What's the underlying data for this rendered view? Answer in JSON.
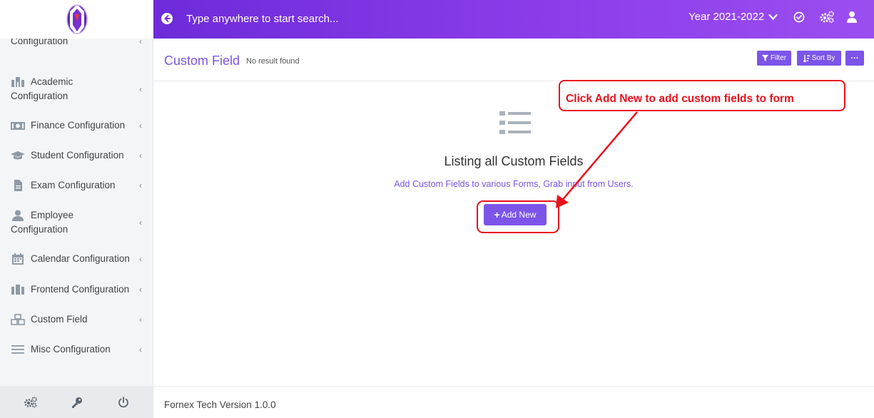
{
  "sidebar": {
    "items": [
      {
        "icon": "reception-icon",
        "line1": "",
        "line2": "Configuration"
      },
      {
        "icon": "academic-icon",
        "line1": "Academic",
        "line2": "Configuration"
      },
      {
        "icon": "finance-icon",
        "label": "Finance Configuration"
      },
      {
        "icon": "graduation-cap-icon",
        "label": "Student Configuration"
      },
      {
        "icon": "file-icon",
        "label": "Exam Configuration"
      },
      {
        "icon": "employee-icon",
        "line1": "Employee",
        "line2": "Configuration"
      },
      {
        "icon": "calendar-icon",
        "label": "Calendar Configuration"
      },
      {
        "icon": "frontend-icon",
        "label": "Frontend Configuration"
      },
      {
        "icon": "cubes-icon",
        "label": "Custom Field"
      },
      {
        "icon": "bars-icon",
        "label": "Misc Configuration"
      }
    ],
    "chevron": "‹",
    "bottom_icons": [
      "cogs-icon",
      "key-icon",
      "power-icon"
    ]
  },
  "topbar": {
    "search_placeholder": "Type anywhere to start search...",
    "year": "Year 2021-2022",
    "icons": [
      "check-circle-icon",
      "cogs-icon",
      "user-icon"
    ]
  },
  "header": {
    "title": "Custom Field",
    "subtitle": "No result found",
    "filter_label": "Filter",
    "sort_label": "Sort By",
    "more_label": "···"
  },
  "main": {
    "listing_title": "Listing all Custom Fields",
    "listing_sub": "Add Custom Fields to various Forms, Grab input from Users.",
    "add_label": "Add New",
    "add_plus": "+"
  },
  "annotation": {
    "text": "Click Add New to add custom fields to form",
    "color": "#e8111d"
  },
  "footer": {
    "version_text": "Fornex Tech Version 1.0.0"
  },
  "colors": {
    "accent": "#7c55e8",
    "topbar_start": "#6d2bd9",
    "topbar_end": "#9b4ef0"
  }
}
